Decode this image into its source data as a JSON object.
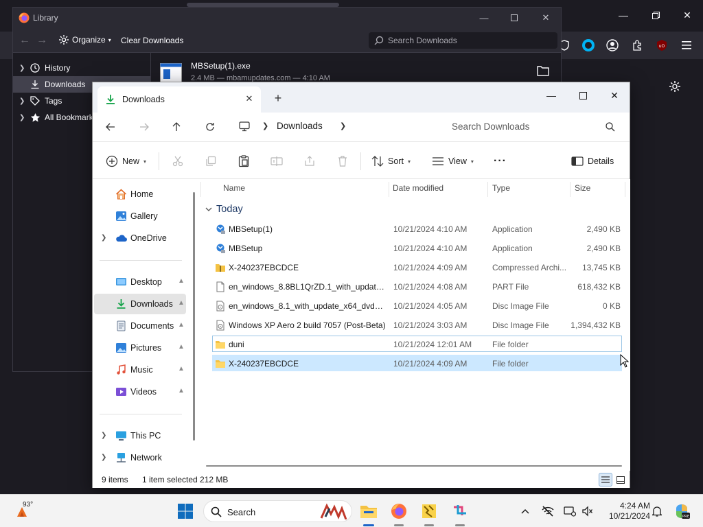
{
  "library": {
    "title": "Library",
    "organize_label": "Organize",
    "clear_label": "Clear Downloads",
    "search_placeholder": "Search Downloads",
    "sidebar": [
      {
        "label": "History",
        "icon": "clock-icon",
        "expandable": true
      },
      {
        "label": "Downloads",
        "icon": "download-icon",
        "expandable": false,
        "selected": true
      },
      {
        "label": "Tags",
        "icon": "tag-icon",
        "expandable": true
      },
      {
        "label": "All Bookmarks",
        "icon": "star-icon",
        "expandable": true
      }
    ],
    "download": {
      "name": "MBSetup(1).exe",
      "meta": "2.4 MB — mbamupdates.com — 4:10 AM"
    }
  },
  "explorer": {
    "tab_label": "Downloads",
    "address_crumb": "Downloads",
    "search_placeholder": "Search Downloads",
    "commands": {
      "new_label": "New",
      "sort_label": "Sort",
      "view_label": "View",
      "more_label": "···",
      "details_label": "Details"
    },
    "sidebar": {
      "top": [
        {
          "label": "Home",
          "icon": "home-icon"
        },
        {
          "label": "Gallery",
          "icon": "gallery-icon"
        },
        {
          "label": "OneDrive",
          "icon": "cloud-icon",
          "expandable": true
        }
      ],
      "quick": [
        {
          "label": "Desktop",
          "icon": "desktop-icon"
        },
        {
          "label": "Downloads",
          "icon": "download-icon",
          "selected": true
        },
        {
          "label": "Documents",
          "icon": "documents-icon"
        },
        {
          "label": "Pictures",
          "icon": "pictures-icon"
        },
        {
          "label": "Music",
          "icon": "music-icon"
        },
        {
          "label": "Videos",
          "icon": "videos-icon"
        }
      ],
      "bottom": [
        {
          "label": "This PC",
          "icon": "pc-icon"
        },
        {
          "label": "Network",
          "icon": "network-icon"
        }
      ]
    },
    "columns": {
      "name": "Name",
      "date": "Date modified",
      "type": "Type",
      "size": "Size"
    },
    "group_label": "Today",
    "files": [
      {
        "name": "MBSetup(1)",
        "date": "10/21/2024 4:10 AM",
        "type": "Application",
        "size": "2,490 KB",
        "icon": "app-icon"
      },
      {
        "name": "MBSetup",
        "date": "10/21/2024 4:10 AM",
        "type": "Application",
        "size": "2,490 KB",
        "icon": "app-icon"
      },
      {
        "name": "X-240237EBCDCE",
        "date": "10/21/2024 4:09 AM",
        "type": "Compressed Archi...",
        "size": "13,745 KB",
        "icon": "zip-icon"
      },
      {
        "name": "en_windows_8.8BL1QrZD.1_with_update_...",
        "date": "10/21/2024 4:08 AM",
        "type": "PART File",
        "size": "618,432 KB",
        "icon": "file-icon"
      },
      {
        "name": "en_windows_8.1_with_update_x64_dvd_6...",
        "date": "10/21/2024 4:05 AM",
        "type": "Disc Image File",
        "size": "0 KB",
        "icon": "disc-icon"
      },
      {
        "name": "Windows XP Aero 2 build 7057 (Post-Beta)",
        "date": "10/21/2024 3:03 AM",
        "type": "Disc Image File",
        "size": "1,394,432 KB",
        "icon": "disc-icon"
      },
      {
        "name": "duni",
        "date": "10/21/2024 12:01 AM",
        "type": "File folder",
        "size": "",
        "icon": "folder-icon",
        "focused": true
      },
      {
        "name": "X-240237EBCDCE",
        "date": "10/21/2024 4:09 AM",
        "type": "File folder",
        "size": "",
        "icon": "folder-icon",
        "selected": true
      }
    ],
    "status": {
      "count": "9 items",
      "selection": "1 item selected",
      "size": "212 MB"
    }
  },
  "taskbar": {
    "temperature": "93°",
    "search_label": "Search",
    "time": "4:24 AM",
    "date": "10/21/2024"
  },
  "colors": {
    "accent": "#0067c0",
    "selection": "#cce8ff",
    "firefox_dark": "#1c1b22"
  }
}
